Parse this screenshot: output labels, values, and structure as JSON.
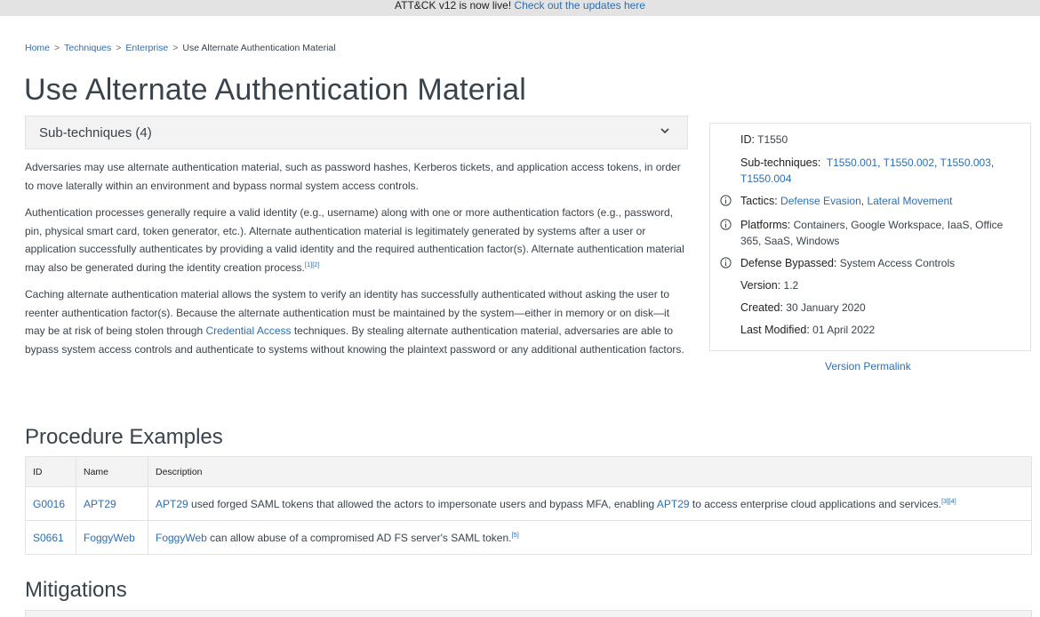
{
  "banner": {
    "text": "ATT&CK v12 is now live!",
    "link": "Check out the updates here"
  },
  "breadcrumb": {
    "items": [
      "Home",
      "Techniques",
      "Enterprise"
    ],
    "current": "Use Alternate Authentication Material",
    "separator": ">"
  },
  "page": {
    "title": "Use Alternate Authentication Material"
  },
  "subtechniques": {
    "label": "Sub-techniques (4)"
  },
  "description": {
    "p1": "Adversaries may use alternate authentication material, such as password hashes, Kerberos tickets, and application access tokens, in order to move laterally within an environment and bypass normal system access controls.",
    "p2": "Authentication processes generally require a valid identity (e.g., username) along with one or more authentication factors (e.g., password, pin, physical smart card, token generator, etc.). Alternate authentication material is legitimately generated by systems after a user or application successfully authenticates by providing a valid identity and the required authentication factor(s). Alternate authentication material may also be generated during the identity creation process.",
    "p2_refs": "[1][2]",
    "p3_before": "Caching alternate authentication material allows the system to verify an identity has successfully authenticated without asking the user to reenter authentication factor(s). Because the alternate authentication must be maintained by the system—either in memory or on disk—it may be at risk of being stolen through ",
    "p3_link": "Credential Access",
    "p3_after": " techniques. By stealing alternate authentication material, adversaries are able to bypass system access controls and authenticate to systems without knowing the plaintext password or any additional authentication factors."
  },
  "card": {
    "id_label": "ID:",
    "id_value": "T1550",
    "sub_label": "Sub-techniques:",
    "sub_values": [
      "T1550.001",
      "T1550.002",
      "T1550.003",
      "T1550.004"
    ],
    "tactics_label": "Tactics:",
    "tactics": [
      "Defense Evasion",
      "Lateral Movement"
    ],
    "platforms_label": "Platforms:",
    "platforms_line1": "Containers, Google Workspace, IaaS, Office",
    "platforms_line2": "365, SaaS, Windows",
    "defense_label": "Defense Bypassed:",
    "defense_value": "System Access Controls",
    "version_label": "Version:",
    "version_value": "1.2",
    "created_label": "Created:",
    "created_value": "30 January 2020",
    "modified_label": "Last Modified:",
    "modified_value": "01 April 2022",
    "permalink": "Version Permalink"
  },
  "procedures": {
    "heading": "Procedure Examples",
    "columns": [
      "ID",
      "Name",
      "Description"
    ],
    "rows": [
      {
        "id": "G0016",
        "name": "APT29",
        "desc_link1": "APT29",
        "desc_mid": " used forged SAML tokens that allowed the actors to impersonate users and bypass MFA, enabling ",
        "desc_link2": "APT29",
        "desc_end": " to access enterprise cloud applications and services.",
        "refs": "[3][4]"
      },
      {
        "id": "S0661",
        "name": "FoggyWeb",
        "desc_link1": "FoggyWeb",
        "desc_end": " can allow abuse of a compromised AD FS server's SAML token.",
        "refs": "[5]"
      }
    ]
  },
  "mitigations": {
    "heading": "Mitigations"
  },
  "colors": {
    "link": "#2e6fb0",
    "text": "#39434c",
    "panel": "#f3f3f3",
    "border": "#e3e3e3"
  }
}
